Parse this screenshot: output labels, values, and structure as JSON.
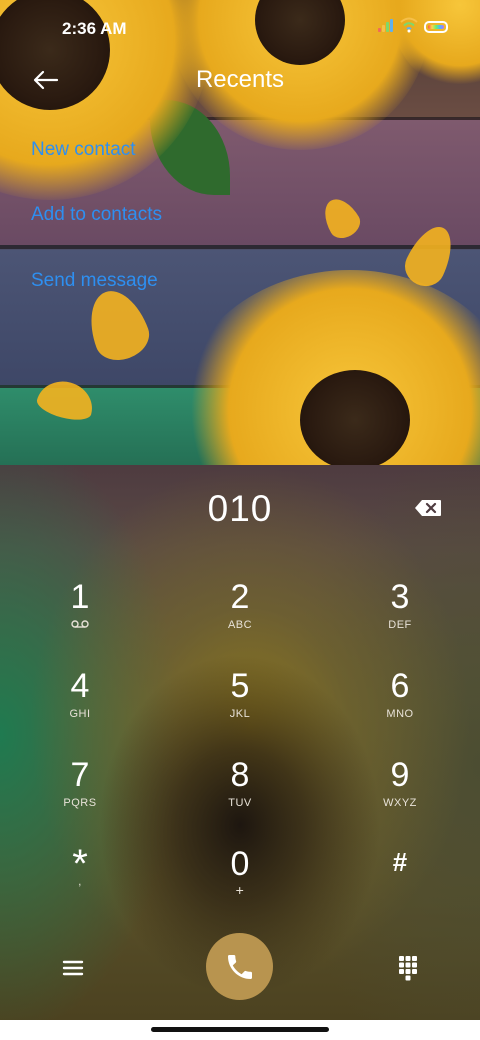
{
  "status_bar": {
    "time": "2:36 AM",
    "icons": [
      "signal-icon",
      "wifi-icon",
      "battery-icon"
    ]
  },
  "header": {
    "title": "Recents",
    "back_icon": "arrow-left-icon"
  },
  "actions": [
    {
      "label": "New contact"
    },
    {
      "label": "Add to contacts"
    },
    {
      "label": "Send message"
    }
  ],
  "dialer": {
    "number": "010",
    "backspace_icon": "backspace-icon",
    "keys": [
      {
        "digit": "1",
        "sub": "voicemail-icon"
      },
      {
        "digit": "2",
        "sub": "ABC"
      },
      {
        "digit": "3",
        "sub": "DEF"
      },
      {
        "digit": "4",
        "sub": "GHI"
      },
      {
        "digit": "5",
        "sub": "JKL"
      },
      {
        "digit": "6",
        "sub": "MNO"
      },
      {
        "digit": "7",
        "sub": "PQRS"
      },
      {
        "digit": "8",
        "sub": "TUV"
      },
      {
        "digit": "9",
        "sub": "WXYZ"
      },
      {
        "digit": "*",
        "sub": ","
      },
      {
        "digit": "0",
        "sub": "+"
      },
      {
        "digit": "#",
        "sub": ""
      }
    ]
  },
  "bottom_bar": {
    "menu_icon": "menu-icon",
    "call_icon": "phone-icon",
    "keypad_icon": "dialpad-icon"
  },
  "colors": {
    "accent": "#2e8ff0",
    "call_button": "#b8944f"
  }
}
